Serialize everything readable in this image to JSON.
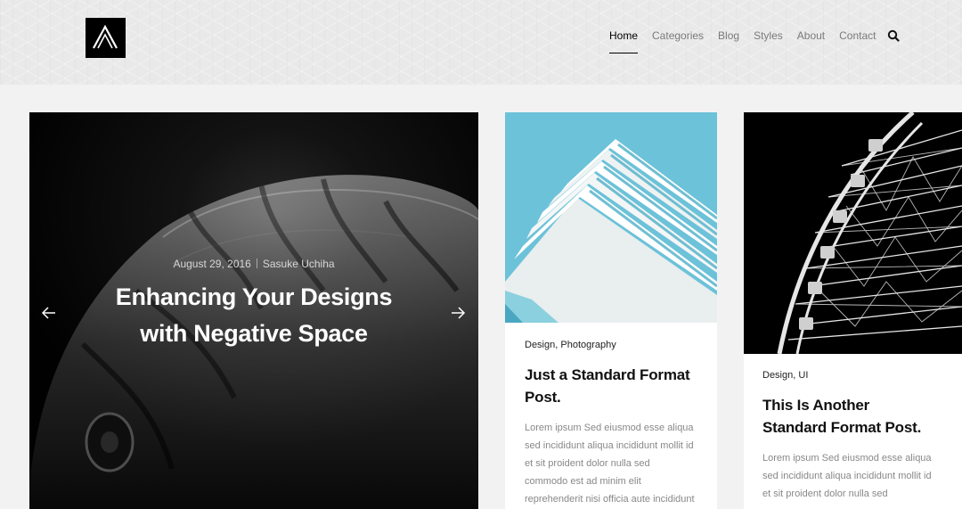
{
  "header": {
    "logo_alt": "site-logo",
    "nav": [
      {
        "label": "Home",
        "active": true
      },
      {
        "label": "Categories",
        "active": false
      },
      {
        "label": "Blog",
        "active": false
      },
      {
        "label": "Styles",
        "active": false
      },
      {
        "label": "About",
        "active": false
      },
      {
        "label": "Contact",
        "active": false
      }
    ],
    "search_icon": "search-icon"
  },
  "hero": {
    "date": "August 29, 2016",
    "author": "Sasuke Uchiha",
    "title_line1": "Enhancing Your Designs",
    "title_line2": "with Negative Space",
    "prev_icon": "arrow-left-icon",
    "next_icon": "arrow-right-icon"
  },
  "posts": [
    {
      "categories": [
        "Design",
        "Photography"
      ],
      "title_line1": "Just a Standard Format",
      "title_line2": "Post.",
      "excerpt_lines": [
        "Lorem ipsum Sed eiusmod esse aliqua",
        "sed incididunt aliqua incididunt mollit id",
        "et sit proident dolor nulla sed",
        "commodo est ad minim elit",
        "reprehenderit nisi officia aute incididunt"
      ]
    },
    {
      "categories": [
        "Design",
        "UI"
      ],
      "title_line1": "This Is Another",
      "title_line2": "Standard Format Post.",
      "excerpt_lines": [
        "Lorem ipsum Sed eiusmod esse aliqua",
        "sed incididunt aliqua incididunt mollit id",
        "et sit proident dolor nulla sed"
      ]
    }
  ],
  "colors": {
    "accent": "#000000",
    "header_bg": "#e9e9e9",
    "page_bg": "#f2f2f2",
    "sky": "#6cc2d9"
  }
}
